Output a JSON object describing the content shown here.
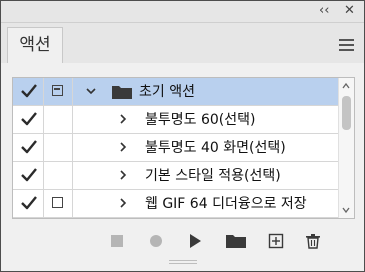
{
  "panel": {
    "collapse_glyph": "‹‹",
    "close_glyph": "✕",
    "tab_label": "액션",
    "menu_icon": "hamburger-menu-icon"
  },
  "actions": [
    {
      "label": "초기 액션",
      "checked": true,
      "dialog": "filled",
      "expanded": true,
      "is_set": true,
      "selected": true
    },
    {
      "label": "불투명도 60(선택)",
      "checked": true,
      "dialog": "none",
      "expanded": false,
      "is_set": false,
      "selected": false
    },
    {
      "label": "불투명도 40 화면(선택)",
      "checked": true,
      "dialog": "none",
      "expanded": false,
      "is_set": false,
      "selected": false
    },
    {
      "label": "기본 스타일 적용(선택)",
      "checked": true,
      "dialog": "none",
      "expanded": false,
      "is_set": false,
      "selected": false
    },
    {
      "label": "웹 GIF 64 디더융으로 저장",
      "checked": true,
      "dialog": "empty",
      "expanded": false,
      "is_set": false,
      "selected": false
    }
  ],
  "colors": {
    "selected_row": "#b9d0ee",
    "icon": "#3a3a3a",
    "disabled_icon": "#b5b5b5"
  },
  "toolbar": [
    "stop-icon",
    "record-icon",
    "play-icon",
    "new-set-folder-icon",
    "new-action-icon",
    "delete-icon"
  ]
}
